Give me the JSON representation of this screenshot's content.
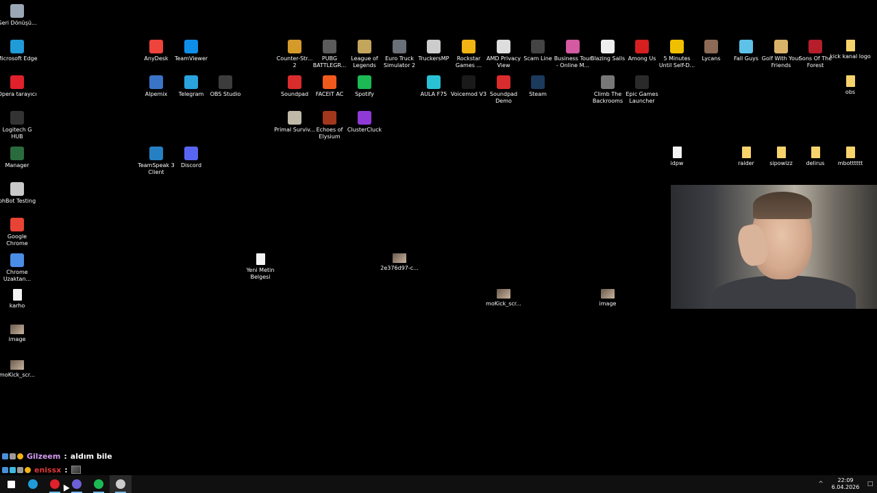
{
  "left_column": [
    {
      "label": "Geri Dönüşü...",
      "icon": "recycle-bin-icon",
      "color": "#9aa7b5"
    },
    {
      "label": "Microsoft Edge",
      "icon": "edge-icon",
      "color": "#1f9bd8"
    },
    {
      "label": "Opera tarayıcı",
      "icon": "opera-icon",
      "color": "#e0202a"
    },
    {
      "label": "Logitech G HUB",
      "icon": "logitech-icon",
      "color": "#333333"
    },
    {
      "label": "Manager",
      "icon": "manager-icon",
      "color": "#2a6b3d"
    },
    {
      "label": "phBot Testing",
      "icon": "phbot-icon",
      "color": "#c8c8c8"
    },
    {
      "label": "Google Chrome",
      "icon": "chrome-icon",
      "color": "#e84335"
    },
    {
      "label": "Chrome Uzaktan...",
      "icon": "chrome-remote-icon",
      "color": "#4a8de6"
    },
    {
      "label": "karho",
      "icon": "file-icon",
      "color": "#ffffff"
    },
    {
      "label": "image",
      "icon": "image-icon",
      "color": "#7c7a78"
    },
    {
      "label": "moKick_scr...",
      "icon": "image-icon",
      "color": "#7c7a78"
    }
  ],
  "desktop_icons": [
    {
      "label": "AnyDesk",
      "icon": "anydesk-icon",
      "color": "#ef443b"
    },
    {
      "label": "TeamViewer",
      "icon": "teamviewer-icon",
      "color": "#0e8ee9"
    },
    {
      "label": "Alpemix",
      "icon": "alpemix-icon",
      "color": "#3a74c7"
    },
    {
      "label": "Telegram",
      "icon": "telegram-icon",
      "color": "#2aa3de"
    },
    {
      "label": "OBS Studio",
      "icon": "obs-icon",
      "color": "#3c3c3c"
    },
    {
      "label": "TeamSpeak 3 Client",
      "icon": "teamspeak-icon",
      "color": "#2580c3"
    },
    {
      "label": "Discord",
      "icon": "discord-icon",
      "color": "#5865f2"
    },
    {
      "label": "Counter-Str... 2",
      "icon": "cs2-icon",
      "color": "#d49a2a"
    },
    {
      "label": "PUBG BATTLEGR...",
      "icon": "pubg-icon",
      "color": "#5b5b5b"
    },
    {
      "label": "League of Legends",
      "icon": "lol-icon",
      "color": "#c3a55b"
    },
    {
      "label": "Euro Truck Simulator 2",
      "icon": "ets2-icon",
      "color": "#6a6f78"
    },
    {
      "label": "TruckersMP",
      "icon": "truckersmp-icon",
      "color": "#cccccc"
    },
    {
      "label": "Rockstar Games ...",
      "icon": "rockstar-icon",
      "color": "#f2b413"
    },
    {
      "label": "AMD Privacy View",
      "icon": "amd-icon",
      "color": "#dddddd"
    },
    {
      "label": "Scam Line",
      "icon": "scamline-icon",
      "color": "#444444"
    },
    {
      "label": "Business Tour - Online M...",
      "icon": "business-tour-icon",
      "color": "#d45aa1"
    },
    {
      "label": "Blazing Sails",
      "icon": "blazing-sails-icon",
      "color": "#eeeeee"
    },
    {
      "label": "Among Us",
      "icon": "among-us-icon",
      "color": "#d61f1f"
    },
    {
      "label": "5 Minutes Until Self-D...",
      "icon": "five-minutes-icon",
      "color": "#f0c000"
    },
    {
      "label": "Lycans",
      "icon": "lycans-icon",
      "color": "#8c6a55"
    },
    {
      "label": "Fall Guys",
      "icon": "fall-guys-icon",
      "color": "#5ec2e8"
    },
    {
      "label": "Golf With Your Friends",
      "icon": "golf-icon",
      "color": "#d9b26a"
    },
    {
      "label": "Sons Of The Forest",
      "icon": "sons-forest-icon",
      "color": "#b51e2a"
    },
    {
      "label": "kick kanal logo",
      "icon": "folder-icon",
      "color": "#f6d36b"
    },
    {
      "label": "Soundpad",
      "icon": "soundpad-icon",
      "color": "#d92c2c"
    },
    {
      "label": "FACEIT AC",
      "icon": "faceit-icon",
      "color": "#f25a1c"
    },
    {
      "label": "Spotify",
      "icon": "spotify-icon",
      "color": "#1db954"
    },
    {
      "label": "AULA F75",
      "icon": "aula-icon",
      "color": "#2bc1d4"
    },
    {
      "label": "Voicemod V3",
      "icon": "voicemod-icon",
      "color": "#1a1a1a"
    },
    {
      "label": "Soundpad Demo",
      "icon": "soundpad-icon",
      "color": "#d92c2c"
    },
    {
      "label": "Steam",
      "icon": "steam-icon",
      "color": "#1b3a5c"
    },
    {
      "label": "Climb The Backrooms",
      "icon": "backrooms-icon",
      "color": "#777777"
    },
    {
      "label": "Epic Games Launcher",
      "icon": "epic-games-icon",
      "color": "#2a2a2a"
    },
    {
      "label": "obs",
      "icon": "folder-icon",
      "color": "#f6d36b"
    },
    {
      "label": "Primal Surviv...",
      "icon": "primal-icon",
      "color": "#c0b9a8"
    },
    {
      "label": "Echoes of Elysium",
      "icon": "echoes-icon",
      "color": "#a2371c"
    },
    {
      "label": "ClusterCluck",
      "icon": "clustercluck-icon",
      "color": "#8f3ad6"
    },
    {
      "label": "idpw",
      "icon": "file-icon",
      "color": "#ffffff"
    },
    {
      "label": "raider",
      "icon": "folder-icon",
      "color": "#f6d36b"
    },
    {
      "label": "sipowizz",
      "icon": "folder-icon",
      "color": "#f6d36b"
    },
    {
      "label": "delirus",
      "icon": "folder-icon",
      "color": "#f6d36b"
    },
    {
      "label": "mbotttttt",
      "icon": "folder-icon",
      "color": "#f6d36b"
    },
    {
      "label": "Yeni Metin Belgesi",
      "icon": "file-icon",
      "color": "#ffffff"
    },
    {
      "label": "2e376d97-c...",
      "icon": "image-icon",
      "color": "#5b7f6a"
    },
    {
      "label": "moKick_scr...",
      "icon": "image-icon",
      "color": "#7c7a78"
    },
    {
      "label": "image",
      "icon": "image-icon",
      "color": "#7c7a78"
    }
  ],
  "chat": [
    {
      "user": "Gilzeem",
      "user_color": "#d49cf5",
      "separator": ":",
      "message": "aldım bile"
    },
    {
      "user": "enissx",
      "user_color": "#e03a3a",
      "separator": ":",
      "message": ""
    }
  ],
  "taskbar": {
    "apps": [
      {
        "name": "start-button",
        "icon": "windows-icon",
        "color": "#ffffff"
      },
      {
        "name": "taskbar-edge",
        "icon": "edge-icon",
        "color": "#1f9bd8"
      },
      {
        "name": "taskbar-opera",
        "icon": "opera-icon",
        "color": "#e0202a"
      },
      {
        "name": "taskbar-chrome-profile",
        "icon": "chrome-icon",
        "color": "#6d5fd6"
      },
      {
        "name": "taskbar-spotify",
        "icon": "spotify-icon",
        "color": "#1db954"
      },
      {
        "name": "taskbar-obs",
        "icon": "obs-icon",
        "color": "#cccccc"
      }
    ],
    "time": "22:09",
    "date": "6.04.2026"
  }
}
